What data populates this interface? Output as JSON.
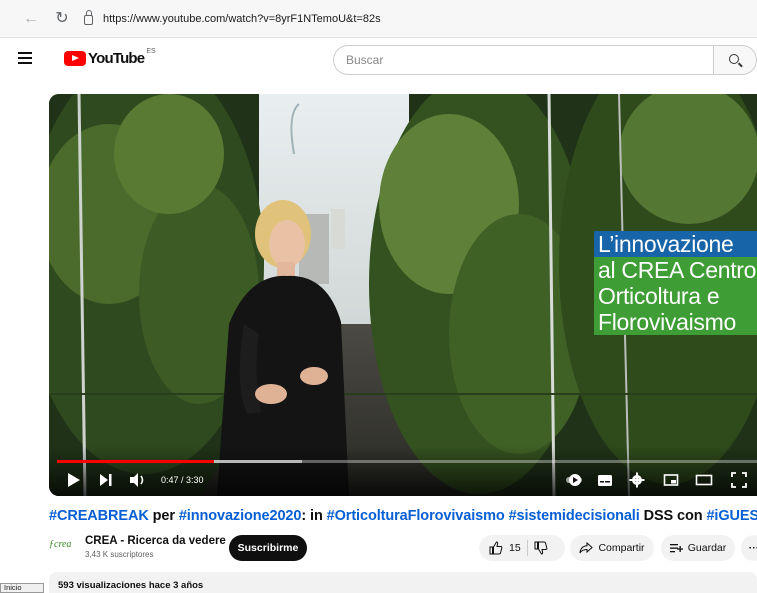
{
  "browser": {
    "url": "https://www.youtube.com/watch?v=8yrF1NTemoU&t=82s"
  },
  "header": {
    "logo_text": "YouTube",
    "country_code": "ES",
    "search_placeholder": "Buscar"
  },
  "player": {
    "time": "0:47 / 3:30",
    "progress_fraction": 0.224,
    "buffered_fraction": 0.35,
    "overlay_lines": [
      "L’innovazione",
      "al CREA Centro",
      "Orticoltura e",
      "Florovivaismo"
    ]
  },
  "video": {
    "title_parts": [
      {
        "text": "#CREABREAK",
        "tag": true
      },
      {
        "text": " per ",
        "tag": false
      },
      {
        "text": "#innovazione2020",
        "tag": true
      },
      {
        "text": ": in ",
        "tag": false
      },
      {
        "text": "#OrticolturaFlorovivaismo",
        "tag": true
      },
      {
        "text": " ",
        "tag": false
      },
      {
        "text": "#sistemidecisionali",
        "tag": true
      },
      {
        "text": " DSS con ",
        "tag": false
      },
      {
        "text": "#iGUESSMED",
        "tag": true
      }
    ]
  },
  "channel": {
    "logo_text": "ƒcrea",
    "name": "CREA - Ricerca da vedere",
    "subscribers": "3,43 K suscriptores",
    "subscribe_label": "Suscribirme"
  },
  "actions": {
    "like_count": "15",
    "share_label": "Compartir",
    "save_label": "Guardar",
    "more_label": "···"
  },
  "description": {
    "meta": "593 visualizaciones  hace 3 años"
  },
  "taskbar": {
    "start_label": "Inicio"
  }
}
